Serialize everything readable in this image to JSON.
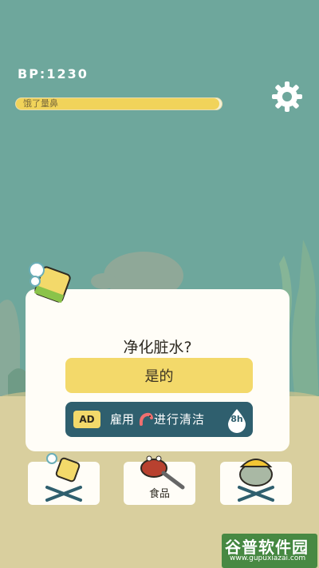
{
  "hud": {
    "bp_text": "BP:1230",
    "status_label": "饿了量鼻",
    "status_fill": 0.99
  },
  "dialog": {
    "prompt": "净化脏水?",
    "yes_label": "是的",
    "ad_tag": "AD",
    "ad_text_before": "雇用",
    "ad_text_after": "进行清洁",
    "ad_timer": "8h"
  },
  "bottom_bar": {
    "items": [
      {
        "label": "",
        "icon": "sponge-icon"
      },
      {
        "label": "食品",
        "icon": "crab-icon"
      },
      {
        "label": "",
        "icon": "worker-fish-icon"
      }
    ]
  },
  "watermark": {
    "title": "谷普软件园",
    "url": "www.gupuxiazai.com"
  },
  "colors": {
    "water": "#6ea79c",
    "sand": "#d9cf9e",
    "accent_yellow": "#f3d96a",
    "ad_button": "#2f5f6e",
    "card": "#fffdf7"
  }
}
